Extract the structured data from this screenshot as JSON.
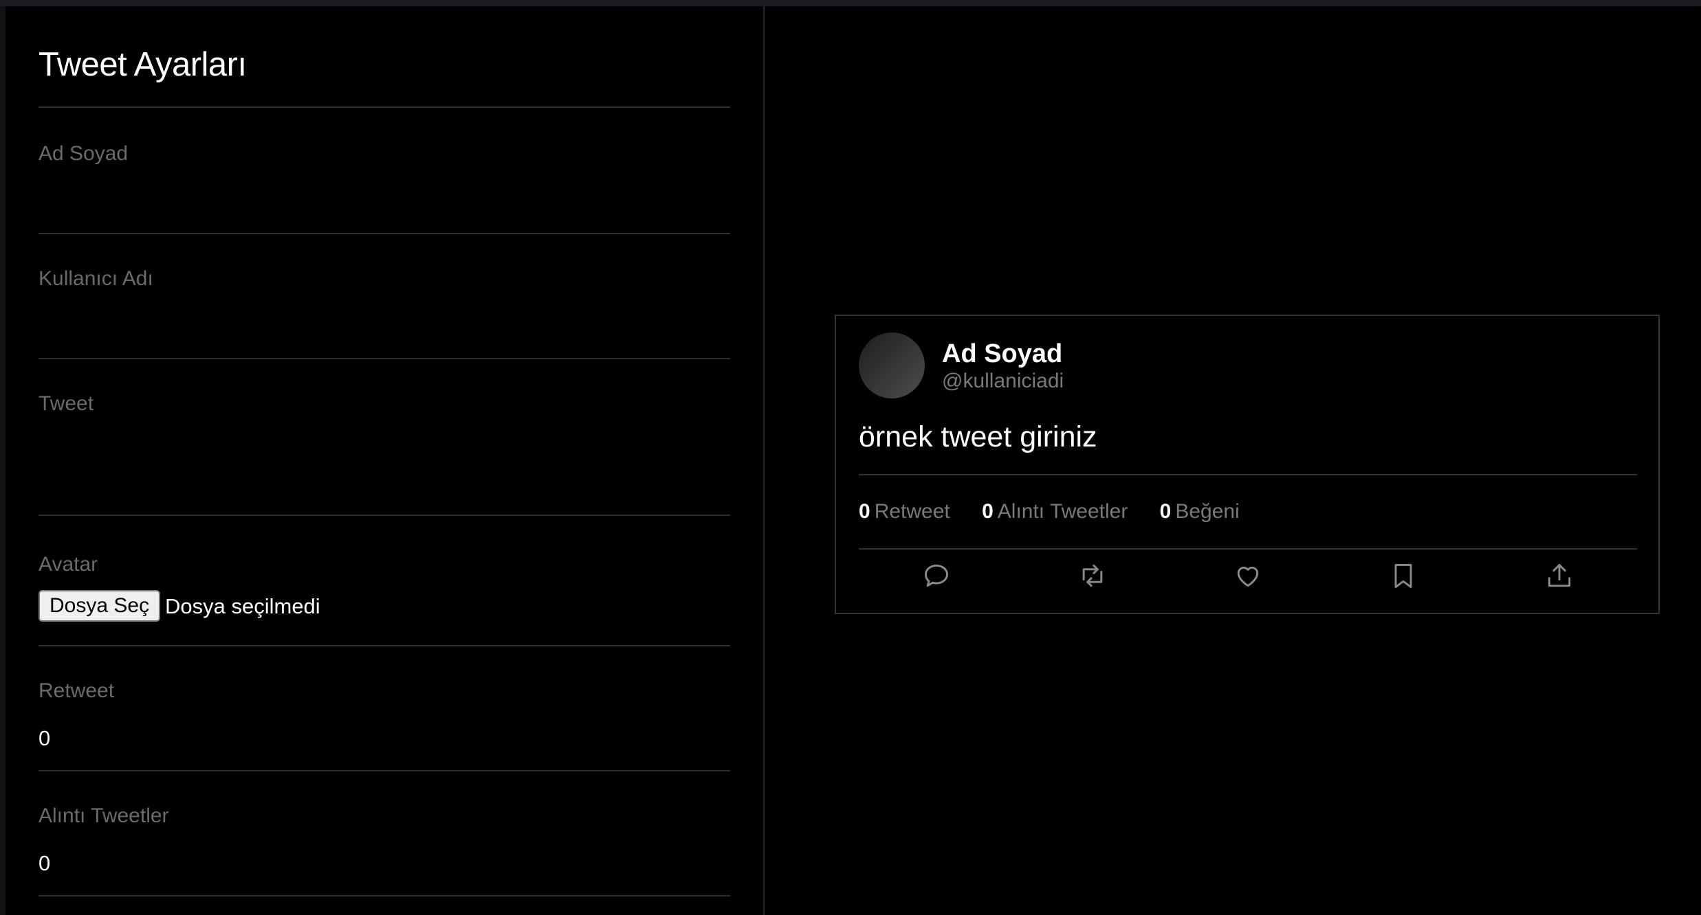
{
  "settings": {
    "title": "Tweet Ayarları",
    "fields": {
      "name": {
        "label": "Ad Soyad",
        "value": ""
      },
      "username": {
        "label": "Kullanıcı Adı",
        "value": ""
      },
      "tweet": {
        "label": "Tweet",
        "value": ""
      },
      "avatar": {
        "label": "Avatar",
        "button_label": "Dosya Seç",
        "status": "Dosya seçilmedi"
      },
      "retweet": {
        "label": "Retweet",
        "value": "0"
      },
      "quotes": {
        "label": "Alıntı Tweetler",
        "value": "0"
      }
    }
  },
  "preview": {
    "name": "Ad Soyad",
    "handle": "@kullaniciadi",
    "text": "örnek tweet giriniz",
    "stats": {
      "retweet_count": "0",
      "retweet_label": "Retweet",
      "quote_count": "0",
      "quote_label": "Alıntı Tweetler",
      "like_count": "0",
      "like_label": "Beğeni"
    },
    "actions": [
      "reply-icon",
      "retweet-icon",
      "like-icon",
      "bookmark-icon",
      "share-icon"
    ]
  },
  "colors": {
    "background": "#000000",
    "label": "#6b6b6b",
    "divider": "#2f2f2f",
    "handle": "#7a7a7a"
  }
}
